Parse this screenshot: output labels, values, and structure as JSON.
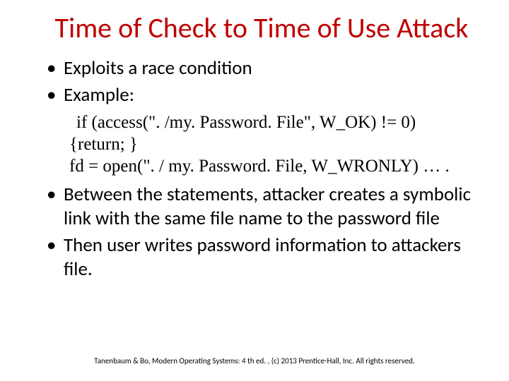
{
  "title": "Time of Check to Time of Use Attack",
  "bullets": {
    "b1": "Exploits a race condition",
    "b2": "Example:",
    "b3": "Between the statements, attacker creates a symbolic link with the same file name to the password file",
    "b4": "Then user writes password information to attackers file."
  },
  "code": {
    "l1": " if (access(\". /my. Password. File\", W_OK) != 0)",
    "l2": "{return; }",
    "l3": "fd = open(\". / my. Password. File, W_WRONLY) … ."
  },
  "footer": "Tanenbaum & Bo, Modern Operating Systems: 4 th ed. , (c) 2013 Prentice-Hall, Inc. All rights reserved."
}
